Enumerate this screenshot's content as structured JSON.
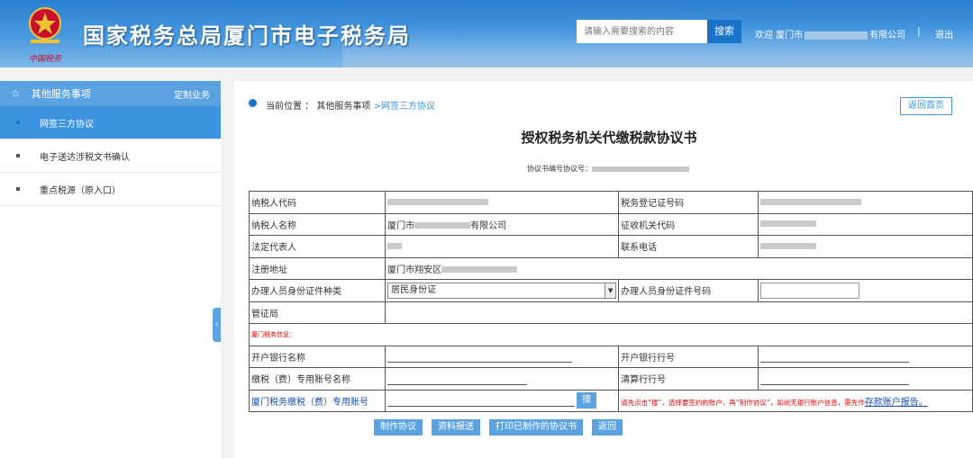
{
  "header": {
    "site_title": "国家税务总局厦门市电子税务局",
    "emblem_script": "中国税务",
    "search_placeholder": "请输入需要搜索的内容",
    "search_button": "搜索",
    "welcome_prefix": "欢迎",
    "welcome_city": "厦门市",
    "welcome_suffix": "有限公司",
    "divider": "|",
    "logout": "退出"
  },
  "sidebar": {
    "title": "其他服务事项",
    "custom_link": "定制业务",
    "items": [
      {
        "label": "网签三方协议",
        "active": true
      },
      {
        "label": "电子送达涉税文书确认",
        "active": false
      },
      {
        "label": "重点税源（原入口）",
        "active": false
      }
    ],
    "collapse_icon": "‹"
  },
  "main": {
    "breadcrumb_prefix": "当前位置 ：",
    "breadcrumb_parent": "其他服务事项",
    "breadcrumb_current": ">网签三方协议",
    "home_button": "返回首页",
    "doc_title": "授权税务机关代缴税款协议书",
    "doc_no_label": "协议书编号协议号：",
    "form": {
      "taxpayer_id_label": "纳税人代码",
      "tax_reg_no_label": "税务登记证号码",
      "taxpayer_name_label": "纳税人名称",
      "taxpayer_name_prefix": "厦门市",
      "taxpayer_name_suffix": "有限公司",
      "tax_office_code_label": "征收机关代码",
      "legal_rep_label": "法定代表人",
      "phone_label": "联系电话",
      "address_label": "注册地址",
      "address_prefix": "厦门市翔安区",
      "id_type_label": "办理人员身份证件种类",
      "id_type_value": "居民身份证",
      "id_no_label": "办理人员身份证件号码",
      "tax_bureau_label": "管征局",
      "section_label": "厦门税务信息：",
      "bank_name_label": "开户银行名称",
      "bank_code_label": "开户银行行号",
      "account_name_label": "缴税（费）专用账号名称",
      "clearing_bank_label": "清算行行号",
      "account_no_label": "厦门税务缴税（费）专用账号",
      "account_search_button": "搜",
      "hint_text": "请先点击“搜”，选择要签约的账户，再“制作协议”，如尚无银行账户信息，需先作",
      "hint_link": "存款账户报告。"
    },
    "actions": [
      "制作协议",
      "资料报送",
      "打印已制作的协议书",
      "返回"
    ]
  },
  "colors": {
    "header_blue": "#2b7fd0",
    "accent": "#3d93e0",
    "warning_red": "#dd0000"
  }
}
